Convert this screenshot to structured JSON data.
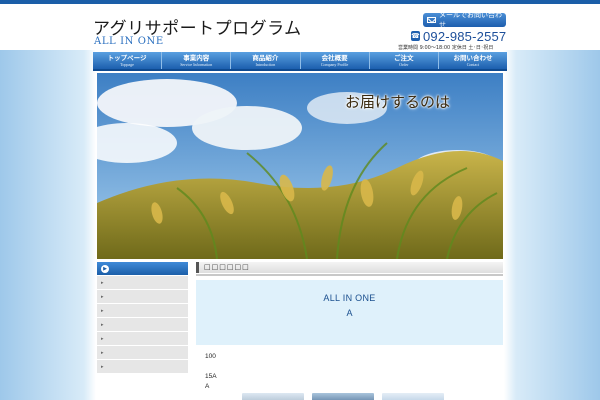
{
  "header": {
    "title": "アグリサポートプログラム",
    "subtitle": "ALL IN ONE",
    "mail_button_label": "メールでお問い合わせ",
    "phone": "092-985-2557",
    "hours": "営業時間 9:00～18:00 定休日 土･日･祝日"
  },
  "nav": {
    "items": [
      {
        "jp": "トップページ",
        "en": "Toppage"
      },
      {
        "jp": "事業内容",
        "en": "Service Information"
      },
      {
        "jp": "商品紹介",
        "en": "Introduction"
      },
      {
        "jp": "会社概要",
        "en": "Company Profile"
      },
      {
        "jp": "ご注文",
        "en": "Order"
      },
      {
        "jp": "お問い合わせ",
        "en": "Contact"
      }
    ]
  },
  "hero": {
    "caption": "お届けするのは"
  },
  "sidebar": {
    "items": [
      "",
      "",
      "",
      "",
      "",
      "",
      "",
      ""
    ]
  },
  "main": {
    "heading": "□□□□□□",
    "intro_title": "ALL IN ONE",
    "intro_sub": "A",
    "line1": "100",
    "line2": "15A",
    "line3": "A"
  },
  "colors": {
    "brand_blue": "#1b5ea8",
    "nav_light": "#5aa0e0",
    "intro_bg": "#dff1fb"
  }
}
